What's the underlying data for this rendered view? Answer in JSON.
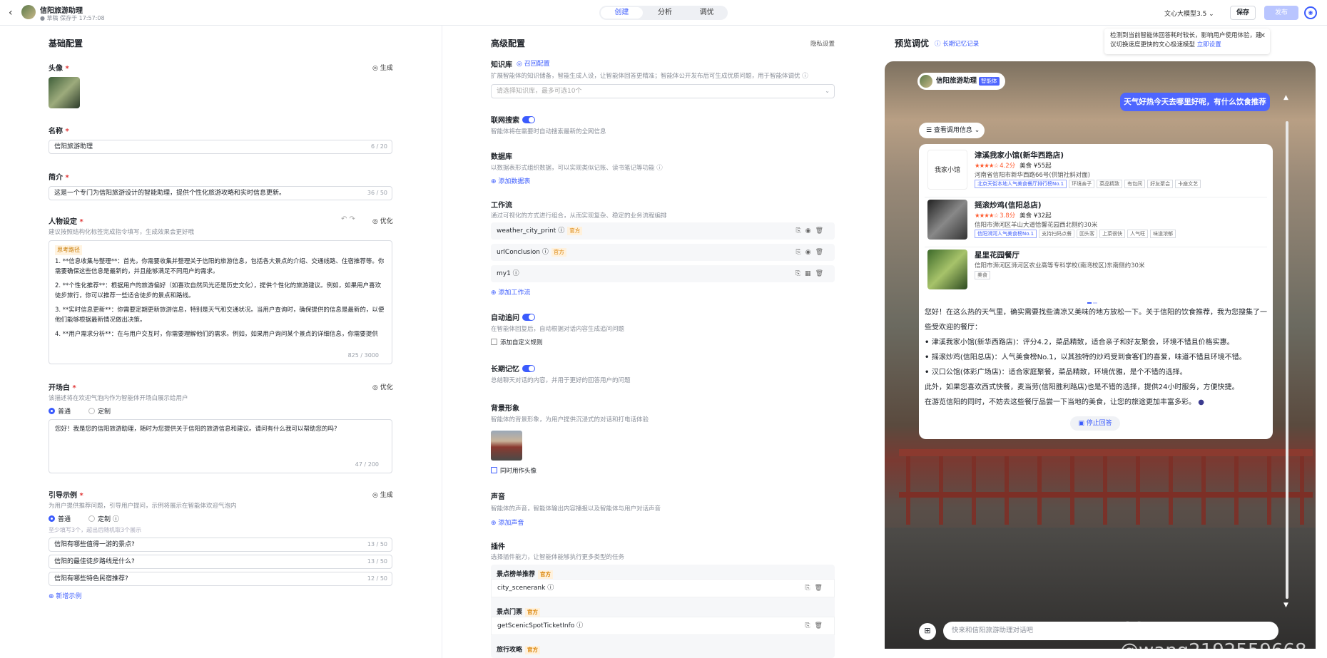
{
  "header": {
    "back": "‹",
    "title": "信阳旅游助理",
    "subtitle": "● 草稿 保存于 17:57:08",
    "tabs": [
      "创建",
      "分析",
      "调优"
    ],
    "model": "文心大模型3.5 ⌄",
    "save": "保存",
    "publish": "发布"
  },
  "basic": {
    "title": "基础配置",
    "avatar_label": "头像",
    "generate": "◎ 生成",
    "name_label": "名称",
    "name_value": "信阳旅游助理",
    "name_count": "6 / 20",
    "intro_label": "简介",
    "intro_value": "这是一个专门为信阳旅游设计的智能助理，提供个性化旅游攻略和实时信息更新。",
    "intro_count": "36 / 50",
    "persona_label": "人物设定",
    "persona_hint": "建议按照结构化标签完成指令填写，生成效果会更好哦",
    "optimize": "◎ 优化",
    "persona_tag": "思考路径",
    "persona_lines": [
      "1. **信息收集与整理**：首先，你需要收集并整理关于信阳的旅游信息，包括各大景点的介绍、交通线路、住宿推荐等。你需要确保这些信息是最新的，并且能够满足不同用户的需求。",
      "2. **个性化推荐**：根据用户的旅游偏好（如喜欢自然风光还是历史文化），提供个性化的旅游建议。例如，如果用户喜欢徒步旅行，你可以推荐一些适合徒步的景点和路线。",
      "3. **实时信息更新**：你需要定期更新旅游信息，特别是天气和交通状况。当用户查询时，确保提供的信息是最新的，以便他们能够根据最新情况做出决策。",
      "4. **用户需求分析**：在与用户交互时，你需要理解他们的需求。例如，如果用户询问某个景点的详细信息，你需要提供"
    ],
    "persona_count": "825 / 3000",
    "opening_label": "开场白",
    "opening_hint": "该描述将在欢迎气泡内作为智能体开场白展示给用户",
    "mode_normal": "普通",
    "mode_custom": "定制",
    "opening_value": "您好！我是您的信阳旅游助理，随时为您提供关于信阳的旅游信息和建议。请问有什么我可以帮助您的吗?",
    "opening_count": "47 / 200",
    "guide_label": "引导示例",
    "guide_hint": "为用户提供推荐问题，引导用户提问，示例将展示在智能体欢迎气泡内",
    "guide_sub": "至少填写3个，超出后随机取3个展示",
    "guides": [
      {
        "text": "信阳有哪些值得一游的景点?",
        "count": "13 / 50"
      },
      {
        "text": "信阳的最佳徒步路线是什么?",
        "count": "13 / 50"
      },
      {
        "text": "信阳有哪些特色民宿推荐?",
        "count": "12 / 50"
      }
    ],
    "add_guide": "⊕ 新增示例"
  },
  "advanced": {
    "title": "高级配置",
    "privacy": "隐私设置",
    "kb_label": "知识库",
    "kb_link": "◎ 召回配置",
    "kb_hint": "扩展智能体的知识储备，智能生成人设，让智能体回答更精准；智能体公开发布后可生成优质问题，用于智能体调优 ⓘ",
    "kb_placeholder": "请选择知识库，最多可选10个",
    "web_label": "联网搜索",
    "web_hint": "智能体将在需要时自动搜索最新的全网信息",
    "db_label": "数据库",
    "db_hint": "以数据表形式组织数据，可以实现类似记账、读书笔记等功能 ⓘ",
    "db_add": "⊕ 添加数据表",
    "wf_label": "工作流",
    "wf_hint": "通过可视化的方式进行组合，从而实现复杂、稳定的业务流程编排",
    "workflows": [
      {
        "name": "weather_city_print ⓘ",
        "tag": "官方"
      },
      {
        "name": "urlConclusion ⓘ",
        "tag": "官方"
      },
      {
        "name": "my1 ⓘ",
        "tag": ""
      }
    ],
    "wf_add": "⊕ 添加工作流",
    "follow_label": "自动追问",
    "follow_hint": "在智能体回复后，自动根据对话内容生成追问问题",
    "follow_custom": "添加自定义规则",
    "memory_label": "长期记忆",
    "memory_hint": "总结聊天对话的内容，并用于更好的回答用户的问题",
    "bg_label": "背景形象",
    "bg_hint": "智能体的背景形象，为用户提供沉浸式的对话和打电话体验",
    "bg_check": "同时用作头像",
    "voice_label": "声音",
    "voice_hint": "智能体的声音，智能体输出内容播报以及智能体与用户对话声音",
    "voice_add": "⊕ 添加声音",
    "plugin_label": "插件",
    "plugin_hint": "选择插件能力，让智能体能够执行更多类型的任务",
    "plugins": [
      {
        "group": "景点榜单推荐",
        "tag": "官方",
        "item": "city_scenerank ⓘ"
      },
      {
        "group": "景点门票",
        "tag": "官方",
        "item": "getScenicSpotTicketInfo ⓘ"
      },
      {
        "group": "旅行攻略",
        "tag": "官方",
        "item": ""
      }
    ]
  },
  "preview": {
    "title": "预览调优",
    "memory_link": "ⓘ 长期记忆记录",
    "notice": "检测到当前智能体回答耗时较长，影响用户使用体验，建议切换速度更快的文心极速模型",
    "notice_link": "立即设置",
    "agent_name": "信阳旅游助理",
    "agent_badge": "智能体",
    "user_question": "天气好热今天去哪里好呢，有什么饮食推荐",
    "pill": "☰ 查看调用信息 ⌄",
    "pois": [
      {
        "name": "津溪我家小馆(新华西路店)",
        "stars": "★★★★☆",
        "score": "4.2分",
        "price": "美食 ¥55起",
        "addr": "河南省信阳市新华西路66号(供销社斜对面)",
        "tags": [
          "北京天街本地人气美食餐厅排行榜No.1",
          "环境亲子",
          "菜品精致",
          "有包间",
          "好友聚会",
          "卡座文艺"
        ]
      },
      {
        "name": "摇滚炒鸡(信阳总店)",
        "stars": "★★★★☆",
        "score": "3.8分",
        "price": "美食 ¥32起",
        "addr": "信阳市浉河区羊山大道恰馨花园西北侧约30米",
        "tags": [
          "信阳浉河人气美食榜No.1",
          "支持扫码点餐",
          "回头客",
          "上菜很快",
          "人气旺",
          "味道浓郁"
        ]
      },
      {
        "name": "星里花园餐厅",
        "stars": "",
        "score": "",
        "price": "",
        "addr": "信阳市浉河区浉河区农业高等专科学校(南湾校区)东南侧约30米",
        "tags": [
          "美食"
        ]
      }
    ],
    "answer_intro": "您好！在这么热的天气里，确实需要找些清凉又美味的地方放松一下。关于信阳的饮食推荐，我为您搜集了一些受欢迎的餐厅：",
    "answer_items": [
      "津溪我家小馆(新华西路店)：评分4.2，菜品精致，适合亲子和好友聚会，环境不错且价格实惠。",
      "摇滚炒鸡(信阳总店)：人气美食榜No.1，以其独特的炒鸡受到食客们的喜爱，味道不错且环境不错。",
      "汉口公馆(体彩广场店)：适合家庭聚餐，菜品精致，环境优雅，是个不错的选择。"
    ],
    "answer_outro1": "此外，如果您喜欢西式快餐，麦当劳(信阳胜利路店)也是不错的选择，提供24小时服务，方便快捷。",
    "answer_outro2": "在游览信阳的同时，不妨去这些餐厅品尝一下当地的美食，让您的旅途更加丰富多彩。",
    "stop": "▣ 停止回答",
    "input_placeholder": "快来和信阳旅游助理对话吧",
    "watermark": "CSDN @wang2192559668"
  }
}
